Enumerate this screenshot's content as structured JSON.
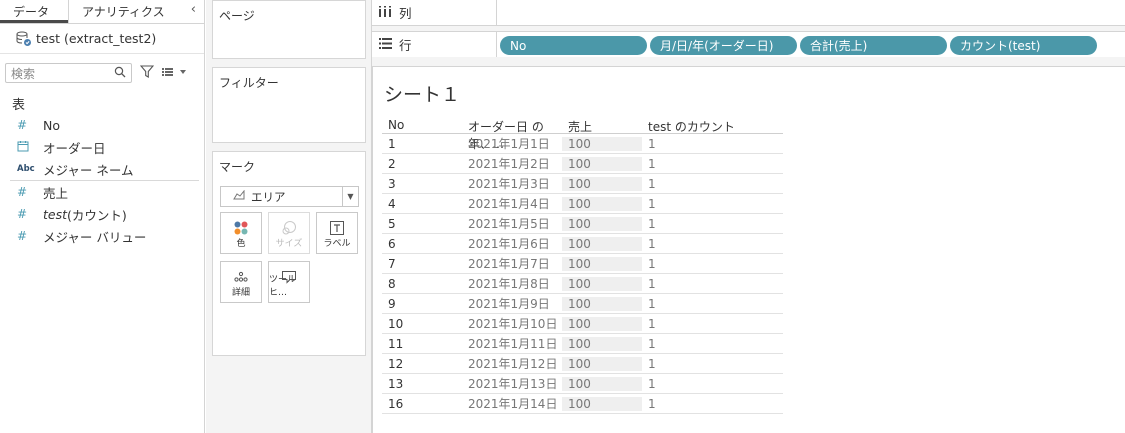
{
  "tabs": [
    {
      "label": "データ"
    },
    {
      "label": "アナリティクス"
    }
  ],
  "collapse_icon": "‹",
  "datasource": {
    "name": "test (extract_test2)"
  },
  "search": {
    "placeholder": "検索"
  },
  "tables_heading": "表",
  "fields_dimensions": [
    {
      "icon": "#",
      "name": "No"
    },
    {
      "icon": "calendar",
      "name": "オーダー日"
    },
    {
      "icon": "Abc",
      "name": "メジャー ネーム"
    }
  ],
  "fields_measures": [
    {
      "icon": "#",
      "name": "売上"
    },
    {
      "icon": "#",
      "name_italic": "test",
      "name_rest": " (カウント)"
    },
    {
      "icon": "#",
      "name": "メジャー バリュー"
    }
  ],
  "cards": {
    "pages": "ページ",
    "filters": "フィルター",
    "marks": "マーク"
  },
  "marks": {
    "type": "エリア",
    "buttons": [
      {
        "label": "色"
      },
      {
        "label": "サイズ"
      },
      {
        "label": "ラベル"
      },
      {
        "label": "詳細"
      },
      {
        "label": "ツールヒ…"
      }
    ]
  },
  "columns_shelf": {
    "label": "列"
  },
  "rows_shelf": {
    "label": "行",
    "pills": [
      "No",
      "月/日/年(オーダー日)",
      "合計(売上)",
      "カウント(test)"
    ]
  },
  "sheet": {
    "title": "シート１"
  },
  "table": {
    "headers": [
      "No",
      "オーダー日 の年、…",
      "売上",
      "test のカウント"
    ],
    "rows": [
      [
        "1",
        "2021年1月1日",
        "100",
        "1"
      ],
      [
        "2",
        "2021年1月2日",
        "100",
        "1"
      ],
      [
        "3",
        "2021年1月3日",
        "100",
        "1"
      ],
      [
        "4",
        "2021年1月4日",
        "100",
        "1"
      ],
      [
        "5",
        "2021年1月5日",
        "100",
        "1"
      ],
      [
        "6",
        "2021年1月6日",
        "100",
        "1"
      ],
      [
        "7",
        "2021年1月7日",
        "100",
        "1"
      ],
      [
        "8",
        "2021年1月8日",
        "100",
        "1"
      ],
      [
        "9",
        "2021年1月9日",
        "100",
        "1"
      ],
      [
        "10",
        "2021年1月10日",
        "100",
        "1"
      ],
      [
        "11",
        "2021年1月11日",
        "100",
        "1"
      ],
      [
        "12",
        "2021年1月12日",
        "100",
        "1"
      ],
      [
        "13",
        "2021年1月13日",
        "100",
        "1"
      ],
      [
        "16",
        "2021年1月14日",
        "100",
        "1"
      ]
    ]
  },
  "colors": {
    "pill": "#4b98a9",
    "field_icon": "#4b9bb2"
  }
}
